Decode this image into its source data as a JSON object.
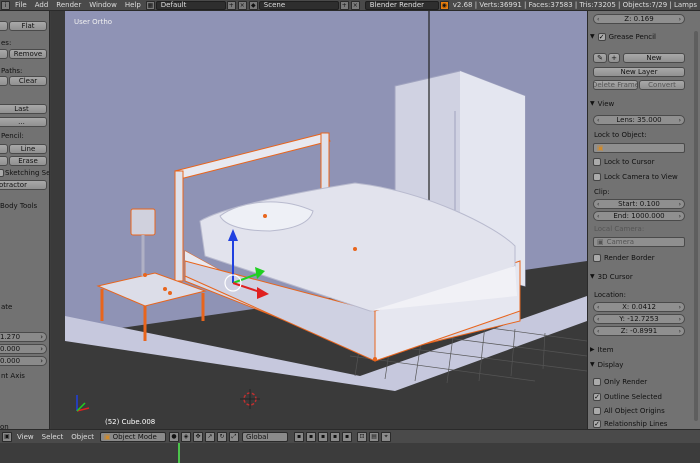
{
  "topbar": {
    "menus": [
      "File",
      "Add",
      "Render",
      "Window",
      "Help"
    ],
    "screen_layout": "Default",
    "scene": "Scene",
    "render_engine": "Blender Render",
    "stats": "v2.68 | Verts:36991 | Faces:37583 | Tris:73205 | Objects:7/29 | Lamps"
  },
  "left_panel": {
    "shade_flat": "Flat",
    "remove_label": "Remove",
    "edges_label": "es:",
    "paths_label": "Paths:",
    "clear_label": "Clear",
    "last_label": "Last",
    "dots_label": "...",
    "pencil_label": "Pencil:",
    "line_label": "Line",
    "erase_label": "Erase",
    "sketching_label": "Sketching Sessi",
    "protractor_label": "otractor",
    "body_tools": "Body Tools",
    "rotate_label": "ate",
    "value_1": "1.270",
    "value_2": "0.000",
    "value_3": "0.000",
    "axis_label": "nt Axis",
    "bottom_label": "on"
  },
  "viewport": {
    "title": "User Ortho",
    "status": "(52) Cube.008"
  },
  "right_panel": {
    "z_top": "Z: 0.169",
    "grease_pencil": "Grease Pencil",
    "new_label": "New",
    "new_layer": "New Layer",
    "delete_frame": "Delete Frame",
    "convert": "Convert",
    "view_header": "View",
    "lens": "Lens: 35.000",
    "lock_to_object": "Lock to Object:",
    "lock_to_cursor": "Lock to Cursor",
    "lock_camera": "Lock Camera to View",
    "clip": "Clip:",
    "clip_start": "Start: 0.100",
    "clip_end": "End: 1000.000",
    "local_camera": "Local Camera:",
    "camera": "Camera",
    "render_border": "Render Border",
    "cursor_header": "3D Cursor",
    "location": "Location:",
    "cursor_x": "X: 0.0412",
    "cursor_y": "Y: -12.7253",
    "cursor_z": "Z: -0.8991",
    "item_header": "Item",
    "display_header": "Display",
    "only_render": "Only Render",
    "outline_selected": "Outline Selected",
    "all_object_origins": "All Object Origins",
    "relationship_lines": "Relationship Lines"
  },
  "bottombar": {
    "menus": [
      "View",
      "Select",
      "Object"
    ],
    "mode": "Object Mode",
    "orientation": "Global"
  },
  "colors": {
    "selection_outline": "#e8651d",
    "gizmo_x": "#e02020",
    "gizmo_y": "#20d020",
    "gizmo_z": "#2040e0"
  }
}
